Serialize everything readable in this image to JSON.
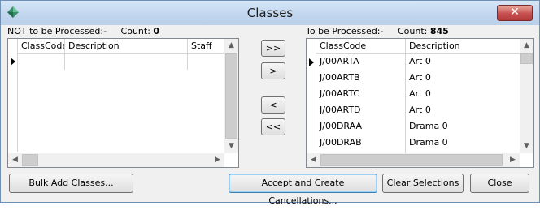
{
  "window": {
    "title": "Classes",
    "close_glyph": "✕"
  },
  "left_panel": {
    "label": "NOT to be Processed:-",
    "count_label": "Count:",
    "count": "0",
    "columns": [
      "ClassCode",
      "Description",
      "Staff"
    ]
  },
  "right_panel": {
    "label": "To be Processed:-",
    "count_label": "Count:",
    "count": "845",
    "columns": [
      "ClassCode",
      "Description"
    ],
    "rows": [
      [
        "J/00ARTA",
        "Art 0"
      ],
      [
        "J/00ARTB",
        "Art 0"
      ],
      [
        "J/00ARTC",
        "Art 0"
      ],
      [
        "J/00ARTD",
        "Art 0"
      ],
      [
        "J/00DRAA",
        "Drama 0"
      ],
      [
        "J/00DRAB",
        "Drama 0"
      ]
    ]
  },
  "transfer": {
    "move_all_right": ">>",
    "move_right": ">",
    "move_left": "<",
    "move_all_left": "<<"
  },
  "footer": {
    "bulk_add": "Bulk Add Classes...",
    "accept": "Accept and Create Cancellations...",
    "clear": "Clear Selections",
    "close": "Close"
  },
  "icons": {
    "scroll_up": "▲",
    "scroll_down": "▼",
    "scroll_left": "◀",
    "scroll_right": "▶"
  }
}
